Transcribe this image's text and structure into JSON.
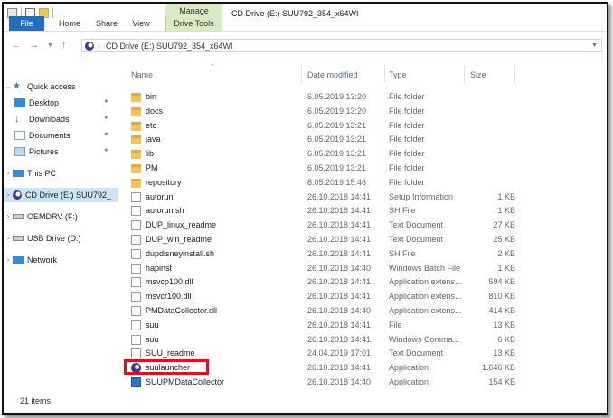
{
  "window": {
    "title": "CD Drive (E:) SUU792_354_x64WI",
    "manage_label": "Manage"
  },
  "ribbon": {
    "tabs": [
      "File",
      "Home",
      "Share",
      "View",
      "Drive Tools"
    ]
  },
  "address": {
    "path": "CD Drive (E:) SUU792_354_x64WI"
  },
  "navpane": {
    "quick_access": "Quick access",
    "items": [
      {
        "label": "Desktop",
        "pinned": true
      },
      {
        "label": "Downloads",
        "pinned": true
      },
      {
        "label": "Documents",
        "pinned": true
      },
      {
        "label": "Pictures",
        "pinned": true
      }
    ],
    "this_pc": "This PC",
    "cd_drive": "CD Drive (E:) SUU792_",
    "oemdrv": "OEMDRV (F:)",
    "usb": "USB Drive (D:)",
    "network": "Network"
  },
  "columns": {
    "name": "Name",
    "date": "Date modified",
    "type": "Type",
    "size": "Size"
  },
  "files": [
    {
      "name": "bin",
      "date": "6.05.2019 13:20",
      "type": "File folder",
      "size": "",
      "icon": "folder"
    },
    {
      "name": "docs",
      "date": "6.05.2019 13:20",
      "type": "File folder",
      "size": "",
      "icon": "folder"
    },
    {
      "name": "etc",
      "date": "6.05.2019 13:21",
      "type": "File folder",
      "size": "",
      "icon": "folder"
    },
    {
      "name": "java",
      "date": "6.05.2019 13:21",
      "type": "File folder",
      "size": "",
      "icon": "folder"
    },
    {
      "name": "lib",
      "date": "6.05.2019 13:21",
      "type": "File folder",
      "size": "",
      "icon": "folder"
    },
    {
      "name": "PM",
      "date": "6.05.2019 13:21",
      "type": "File folder",
      "size": "",
      "icon": "folder"
    },
    {
      "name": "repository",
      "date": "8.05.2019 15:46",
      "type": "File folder",
      "size": "",
      "icon": "folder"
    },
    {
      "name": "autorun",
      "date": "26.10.2018 14:41",
      "type": "Setup Information",
      "size": "1 KB",
      "icon": "file"
    },
    {
      "name": "autorun.sh",
      "date": "26.10.2018 14:41",
      "type": "SH File",
      "size": "1 KB",
      "icon": "file"
    },
    {
      "name": "DUP_linux_readme",
      "date": "26.10.2018 14:41",
      "type": "Text Document",
      "size": "27 KB",
      "icon": "file"
    },
    {
      "name": "DUP_win_readme",
      "date": "26.10.2018 14:41",
      "type": "Text Document",
      "size": "25 KB",
      "icon": "file"
    },
    {
      "name": "dupdisneyinstall.sh",
      "date": "26.10.2018 14:41",
      "type": "SH File",
      "size": "2 KB",
      "icon": "file"
    },
    {
      "name": "hapinst",
      "date": "26.10.2018 14:40",
      "type": "Windows Batch File",
      "size": "1 KB",
      "icon": "file"
    },
    {
      "name": "msvcp100.dll",
      "date": "26.10.2018 14:41",
      "type": "Application extens...",
      "size": "594 KB",
      "icon": "file"
    },
    {
      "name": "msvcr100.dll",
      "date": "26.10.2018 14:41",
      "type": "Application extens...",
      "size": "810 KB",
      "icon": "file"
    },
    {
      "name": "PMDataCollector.dll",
      "date": "26.10.2018 14:40",
      "type": "Application extens...",
      "size": "414 KB",
      "icon": "file"
    },
    {
      "name": "suu",
      "date": "26.10.2018 14:41",
      "type": "File",
      "size": "13 KB",
      "icon": "file"
    },
    {
      "name": "suu",
      "date": "26.10.2018 14:41",
      "type": "Windows Comma...",
      "size": "6 KB",
      "icon": "file"
    },
    {
      "name": "SUU_readme",
      "date": "24.04.2019 17:01",
      "type": "Text Document",
      "size": "13 KB",
      "icon": "file"
    },
    {
      "name": "suulauncher",
      "date": "26.10.2018 14:41",
      "type": "Application",
      "size": "1.646 KB",
      "icon": "app"
    },
    {
      "name": "SUUPMDataCollector",
      "date": "26.10.2018 14:40",
      "type": "Application",
      "size": "154 KB",
      "icon": "win"
    }
  ],
  "status": {
    "item_count": "21 items"
  },
  "colors": {
    "file_tab": "#1f6fbd",
    "manage": "#d9ebc5",
    "selection": "#cce4f7",
    "highlight_box": "#e3101c"
  }
}
